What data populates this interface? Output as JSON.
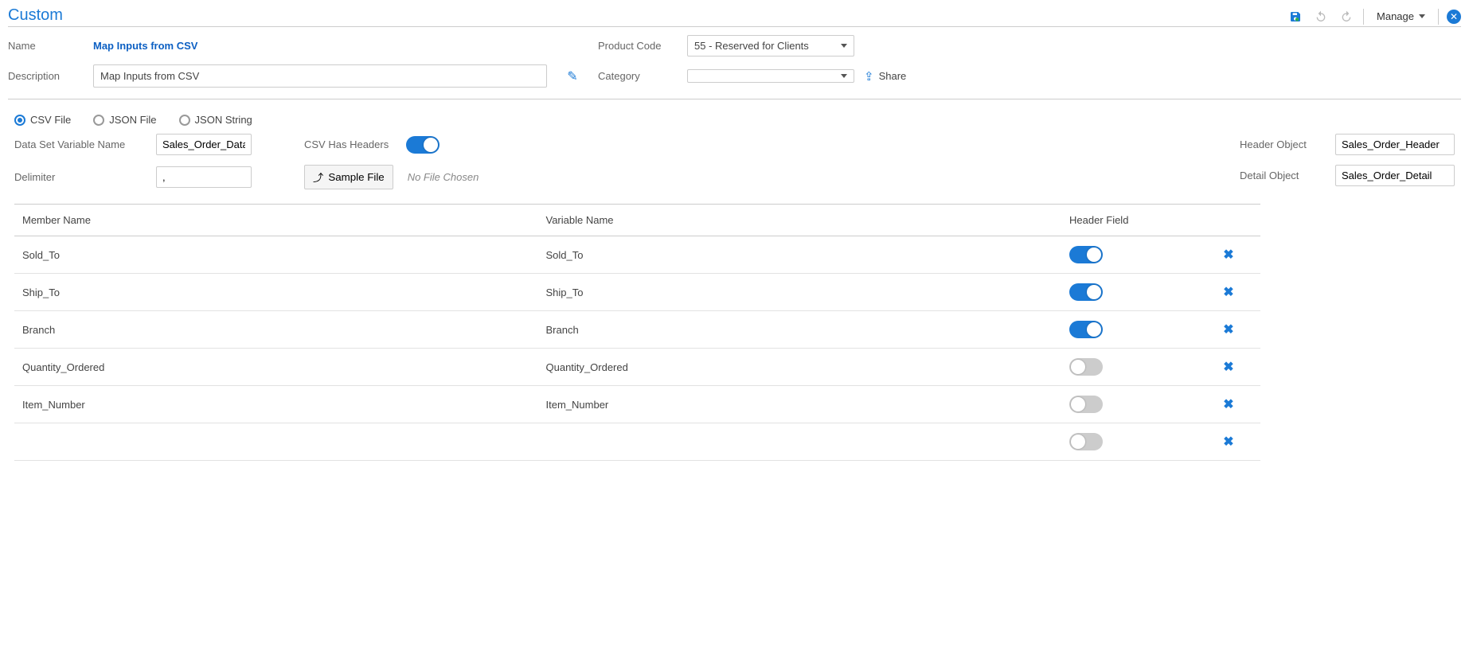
{
  "title": "Custom",
  "toolbar": {
    "manage_label": "Manage"
  },
  "header": {
    "name_label": "Name",
    "name_value": "Map Inputs from CSV",
    "description_label": "Description",
    "description_value": "Map Inputs from CSV",
    "product_code_label": "Product Code",
    "product_code_value": "55 - Reserved for Clients",
    "category_label": "Category",
    "category_value": "",
    "share_label": "Share"
  },
  "source": {
    "radios": {
      "csv_file": "CSV File",
      "json_file": "JSON File",
      "json_string": "JSON String"
    },
    "dataset_var_label": "Data Set Variable Name",
    "dataset_var_value": "Sales_Order_Data",
    "csv_headers_label": "CSV Has Headers",
    "delimiter_label": "Delimiter",
    "delimiter_value": ",",
    "sample_file_btn": "Sample File",
    "no_file": "No File Chosen",
    "header_obj_label": "Header Object",
    "header_obj_value": "Sales_Order_Header",
    "detail_obj_label": "Detail Object",
    "detail_obj_value": "Sales_Order_Detail"
  },
  "table": {
    "cols": {
      "member": "Member Name",
      "variable": "Variable Name",
      "header_field": "Header Field"
    },
    "rows": [
      {
        "member": "Sold_To",
        "variable": "Sold_To",
        "header": true
      },
      {
        "member": "Ship_To",
        "variable": "Ship_To",
        "header": true
      },
      {
        "member": "Branch",
        "variable": "Branch",
        "header": true
      },
      {
        "member": "Quantity_Ordered",
        "variable": "Quantity_Ordered",
        "header": false
      },
      {
        "member": "Item_Number",
        "variable": "Item_Number",
        "header": false
      },
      {
        "member": "",
        "variable": "",
        "header": false
      }
    ]
  }
}
